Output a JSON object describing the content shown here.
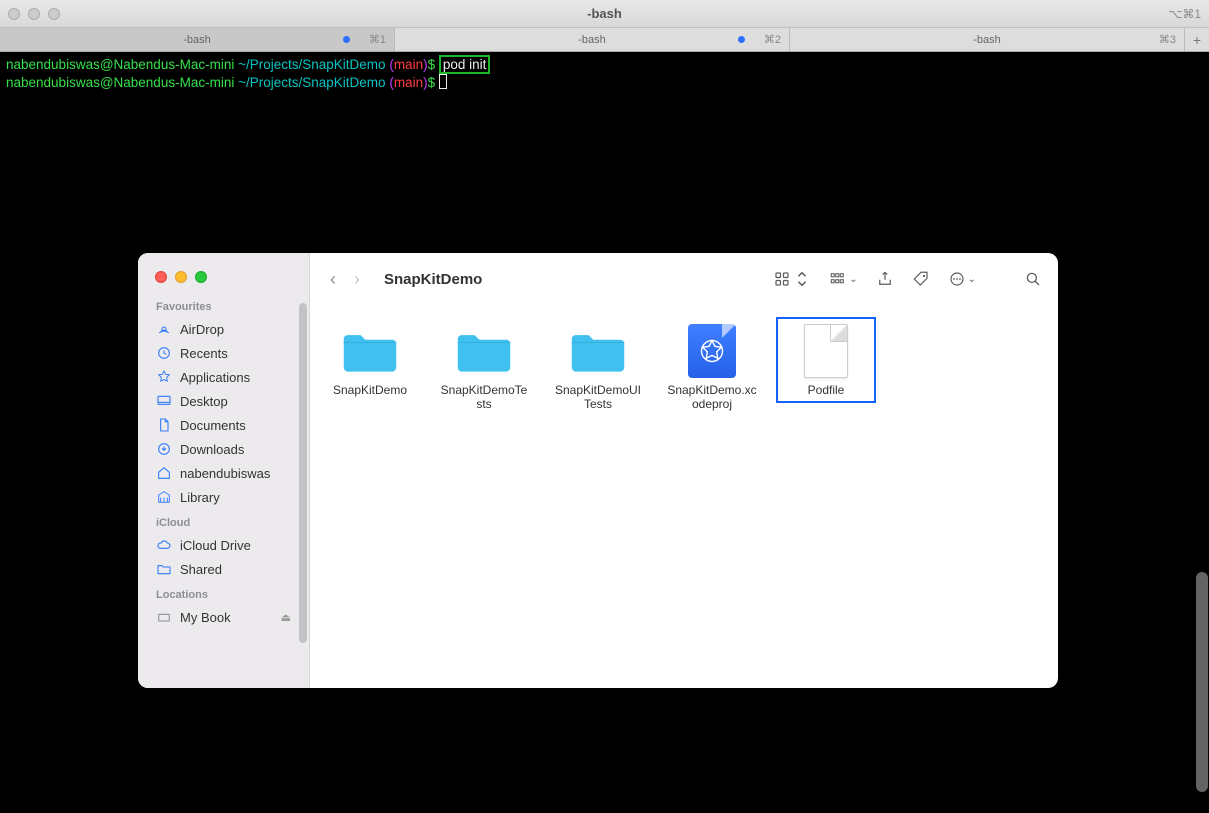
{
  "window": {
    "title": "-bash",
    "shortcut_right": "⌥⌘1"
  },
  "terminal_tabs": [
    {
      "label": "-bash",
      "shortcut": "⌘1",
      "active": true,
      "dot": true
    },
    {
      "label": "-bash",
      "shortcut": "⌘2",
      "active": false,
      "dot": true
    },
    {
      "label": "-bash",
      "shortcut": "⌘3",
      "active": false,
      "dot": false
    }
  ],
  "terminal_lines": [
    {
      "user": "nabendubiswas@Nabendus-Mac-mini",
      "path": "~/Projects/SnapKitDemo",
      "branch": "main",
      "cmd": "pod init",
      "boxed": true
    },
    {
      "user": "nabendubiswas@Nabendus-Mac-mini",
      "path": "~/Projects/SnapKitDemo",
      "branch": "main",
      "cmd": "",
      "boxed": false,
      "cursor": true
    }
  ],
  "finder": {
    "title": "SnapKitDemo",
    "sidebar": {
      "sections": [
        {
          "label": "Favourites",
          "items": [
            "AirDrop",
            "Recents",
            "Applications",
            "Desktop",
            "Documents",
            "Downloads",
            "nabendubiswas",
            "Library"
          ]
        },
        {
          "label": "iCloud",
          "items": [
            "iCloud Drive",
            "Shared"
          ]
        },
        {
          "label": "Locations",
          "items": [
            "My Book"
          ]
        }
      ]
    },
    "files": [
      {
        "name": "SnapKitDemo",
        "type": "folder",
        "selected": false
      },
      {
        "name": "SnapKitDemoTests",
        "type": "folder",
        "selected": false
      },
      {
        "name": "SnapKitDemoUITests",
        "type": "folder",
        "selected": false
      },
      {
        "name": "SnapKitDemo.xcodeproj",
        "type": "xcodeproj",
        "selected": false
      },
      {
        "name": "Podfile",
        "type": "document",
        "selected": true
      }
    ]
  },
  "colors": {
    "folder": "#3fc0ef",
    "selection": "#1463ff"
  }
}
